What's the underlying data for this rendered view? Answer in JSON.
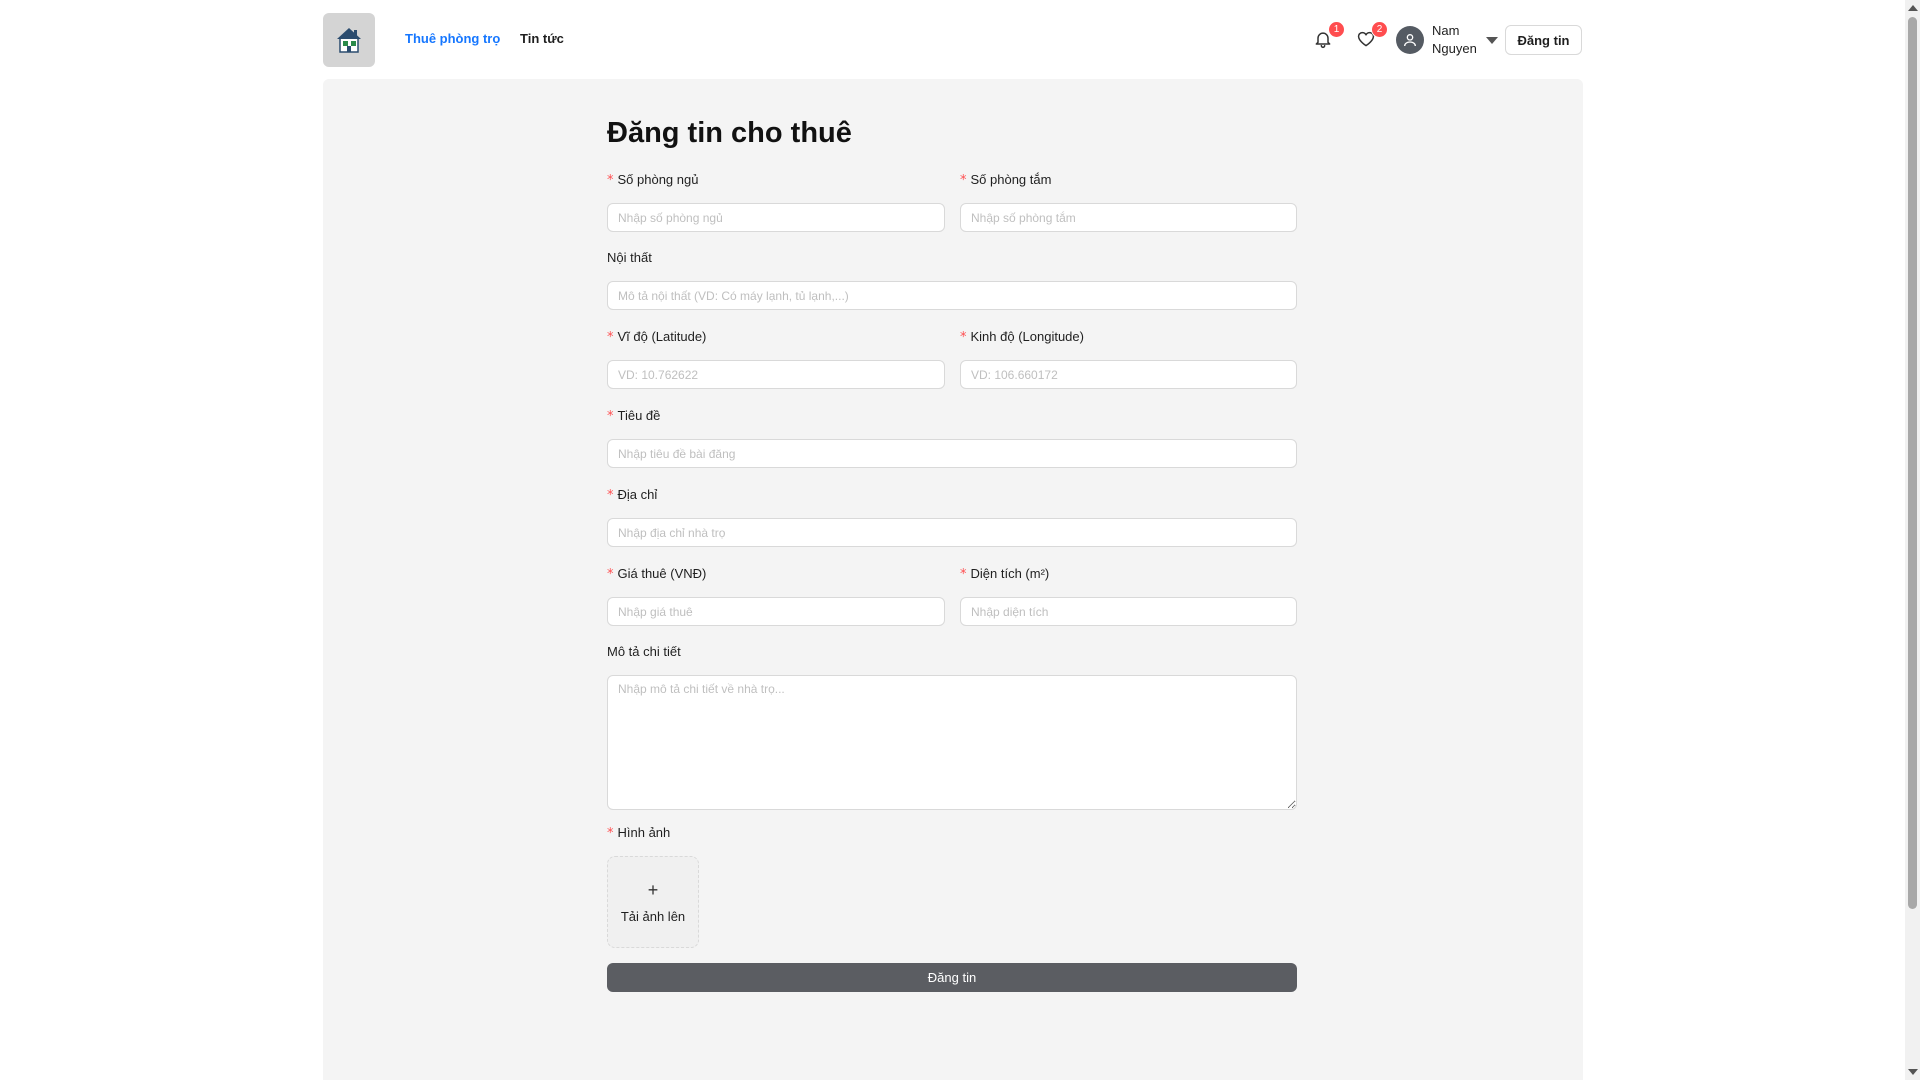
{
  "header": {
    "nav": [
      {
        "label": "Thuê phòng trọ",
        "active": true
      },
      {
        "label": "Tin tức",
        "active": false
      }
    ],
    "notifications_count": "1",
    "favorites_count": "2",
    "user": {
      "name": "Nam Nguyen"
    },
    "post_button": "Đăng tin"
  },
  "form": {
    "title": "Đăng tin cho thuê",
    "bedrooms": {
      "label": "Số phòng ngủ",
      "placeholder": "Nhập số phòng ngủ",
      "value": ""
    },
    "bathrooms": {
      "label": "Số phòng tắm",
      "placeholder": "Nhập số phòng tắm",
      "value": ""
    },
    "furniture": {
      "label": "Nội thất",
      "placeholder": "Mô tả nội thất (VD: Có máy lạnh, tủ lạnh,...)",
      "value": ""
    },
    "latitude": {
      "label": "Vĩ độ (Latitude)",
      "placeholder": "VD: 10.762622",
      "value": ""
    },
    "longitude": {
      "label": "Kinh độ (Longitude)",
      "placeholder": "VD: 106.660172",
      "value": ""
    },
    "title_field": {
      "label": "Tiêu đề",
      "placeholder": "Nhập tiêu đề bài đăng",
      "value": ""
    },
    "address": {
      "label": "Địa chỉ",
      "placeholder": "Nhập địa chỉ nhà trọ",
      "value": ""
    },
    "price": {
      "label": "Giá thuê (VNĐ)",
      "placeholder": "Nhập giá thuê",
      "value": ""
    },
    "area": {
      "label": "Diện tích (m²)",
      "placeholder": "Nhập diện tích",
      "value": ""
    },
    "description": {
      "label": "Mô tả chi tiết",
      "placeholder": "Nhập mô tả chi tiết về nhà trọ...",
      "value": ""
    },
    "images": {
      "label": "Hình ảnh",
      "upload_plus": "+",
      "upload_text": "Tải ảnh lên"
    },
    "required_mark": "*",
    "submit": "Đăng tin"
  },
  "colors": {
    "accent": "#1677ff",
    "required": "#ff4d4f",
    "badge": "#ff4d4f",
    "submit_bg": "#5b5d62",
    "main_bg": "#f4f4f4"
  },
  "icons": [
    "house-logo-icon",
    "bell-icon",
    "heart-icon",
    "user-icon",
    "chevron-down-icon",
    "plus-icon"
  ]
}
